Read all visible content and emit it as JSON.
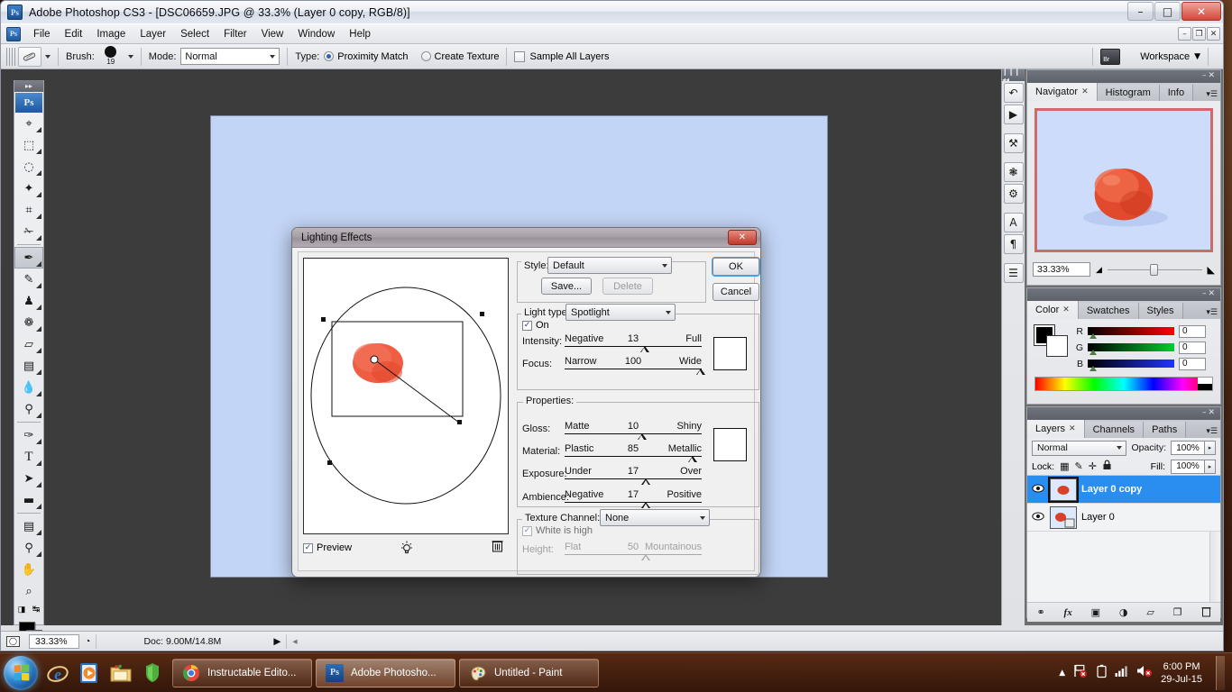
{
  "window": {
    "title": "Adobe Photoshop CS3 - [DSC06659.JPG @ 33.3% (Layer 0 copy, RGB/8)]",
    "app_badge": "Ps",
    "minimize": "–",
    "maximize": "□",
    "close": "✕"
  },
  "doc_buttons": {
    "minimize": "–",
    "restore": "❐",
    "close": "✕"
  },
  "menu": {
    "badge": "Ps",
    "items": [
      "File",
      "Edit",
      "Image",
      "Layer",
      "Select",
      "Filter",
      "View",
      "Window",
      "Help"
    ]
  },
  "options_bar": {
    "tool_icon": "spot-healing-brush-icon",
    "brush_label": "Brush:",
    "brush_size": "19",
    "mode_label": "Mode:",
    "mode_value": "Normal",
    "type_label": "Type:",
    "proximity_match": "Proximity Match",
    "create_texture": "Create Texture",
    "sample_all_layers": "Sample All Layers",
    "bridge_icon": "Br",
    "workspace_label": "Workspace",
    "caret": "▼",
    "check": "✓"
  },
  "toolbox": {
    "grip": "▸▸",
    "badge": "Ps",
    "tools": [
      {
        "name": "move-tool",
        "glyph": "⬌",
        "has_flyout": true
      },
      {
        "name": "rectangular-marquee-tool",
        "glyph": "⬚",
        "has_flyout": true
      },
      {
        "name": "lasso-tool",
        "glyph": "◌",
        "has_flyout": true
      },
      {
        "name": "magic-wand-tool",
        "glyph": "✦",
        "has_flyout": true
      },
      {
        "name": "crop-tool",
        "glyph": "⌘",
        "has_flyout": true
      },
      {
        "name": "slice-tool",
        "glyph": "✂",
        "has_flyout": true
      },
      {
        "name": "spot-healing-brush-tool",
        "glyph": "✒",
        "has_flyout": true,
        "selected": true
      },
      {
        "name": "brush-tool",
        "glyph": "✎",
        "has_flyout": true
      },
      {
        "name": "clone-stamp-tool",
        "glyph": "♟",
        "has_flyout": true
      },
      {
        "name": "history-brush-tool",
        "glyph": "❁",
        "has_flyout": true
      },
      {
        "name": "eraser-tool",
        "glyph": "▱",
        "has_flyout": true
      },
      {
        "name": "gradient-tool",
        "glyph": "▣",
        "has_flyout": true
      },
      {
        "name": "blur-tool",
        "glyph": "●",
        "has_flyout": true
      },
      {
        "name": "dodge-tool",
        "glyph": "⚲",
        "has_flyout": true
      },
      {
        "name": "pen-tool",
        "glyph": "✑",
        "has_flyout": true
      },
      {
        "name": "horizontal-type-tool",
        "glyph": "T",
        "has_flyout": true
      },
      {
        "name": "path-selection-tool",
        "glyph": "➤",
        "has_flyout": true
      },
      {
        "name": "rectangle-tool",
        "glyph": "▬",
        "has_flyout": true
      },
      {
        "name": "notes-tool",
        "glyph": "☰",
        "has_flyout": true
      },
      {
        "name": "eyedropper-tool",
        "glyph": "⚗",
        "has_flyout": true
      },
      {
        "name": "hand-tool",
        "glyph": "✋",
        "has_flyout": false
      },
      {
        "name": "zoom-tool",
        "glyph": "⌕",
        "has_flyout": false
      }
    ],
    "swap_icon": "↹",
    "default_colors_icon": "◨",
    "quickmask_icon": "◯"
  },
  "dialog": {
    "title": "Lighting Effects",
    "close": "✕",
    "preview_checkbox_label": "Preview",
    "preview_checked": "✓",
    "light_bulb_icon": "☀",
    "trash_icon": "Ὕ1",
    "style": {
      "label": "Style:",
      "value": "Default",
      "save_button": "Save...",
      "delete_button": "Delete",
      "caret": "▼"
    },
    "ok_button": "OK",
    "cancel_button": "Cancel",
    "light_type": {
      "label": "Light type:",
      "value": "Spotlight",
      "on_label": "On",
      "on_checked": "✓",
      "color_swatch": "#ffffff"
    },
    "sliders": [
      {
        "name": "intensity",
        "label": "Intensity:",
        "min_label": "Negative",
        "max_label": "Full",
        "value": "13",
        "pos_pct": 55
      },
      {
        "name": "focus",
        "label": "Focus:",
        "min_label": "Narrow",
        "max_label": "Wide",
        "value": "100",
        "pos_pct": 97
      }
    ],
    "properties": {
      "group_label": "Properties:",
      "color_swatch": "#ffffff",
      "sliders": [
        {
          "name": "gloss",
          "label": "Gloss:",
          "min_label": "Matte",
          "max_label": "Shiny",
          "value": "10",
          "pos_pct": 54
        },
        {
          "name": "material",
          "label": "Material:",
          "min_label": "Plastic",
          "max_label": "Metallic",
          "value": "85",
          "pos_pct": 91
        },
        {
          "name": "exposure",
          "label": "Exposure:",
          "min_label": "Under",
          "max_label": "Over",
          "value": "17",
          "pos_pct": 57
        },
        {
          "name": "ambience",
          "label": "Ambience:",
          "min_label": "Negative",
          "max_label": "Positive",
          "value": "17",
          "pos_pct": 57
        }
      ]
    },
    "texture": {
      "group_label": "Texture Channel:",
      "value": "None",
      "caret": "▼",
      "white_is_high_label": "White is high",
      "white_is_high_checked": "✓",
      "height": {
        "label": "Height:",
        "min_label": "Flat",
        "max_label": "Mountainous",
        "value": "50",
        "pos_pct": 57
      }
    }
  },
  "dock_rail": {
    "grip": "❙❙❙ ◂◂",
    "icons": [
      {
        "name": "history-icon",
        "glyph": "↶"
      },
      {
        "name": "actions-icon",
        "glyph": "▶"
      },
      {
        "name": "tool-presets-icon",
        "glyph": "⚒"
      },
      {
        "name": "brushes-icon",
        "glyph": "❃"
      },
      {
        "name": "clone-source-icon",
        "glyph": "⚙"
      },
      {
        "name": "character-icon",
        "glyph": "A"
      },
      {
        "name": "paragraph-icon",
        "glyph": "¶"
      },
      {
        "name": "layer-comps-icon",
        "glyph": "☰"
      }
    ]
  },
  "navigator_panel": {
    "tabs": [
      {
        "label": "Navigator",
        "active": true,
        "closable": true
      },
      {
        "label": "Histogram",
        "active": false,
        "closable": false
      },
      {
        "label": "Info",
        "active": false,
        "closable": false
      }
    ],
    "menu_icon": "▾☰",
    "minimize": "–",
    "close": "✕",
    "zoom_value": "33.33%",
    "zoom_out_icon": "◢",
    "zoom_in_icon": "◣"
  },
  "color_panel": {
    "tabs": [
      {
        "label": "Color",
        "active": true,
        "closable": true
      },
      {
        "label": "Swatches",
        "active": false,
        "closable": false
      },
      {
        "label": "Styles",
        "active": false,
        "closable": false
      }
    ],
    "menu_icon": "▾☰",
    "minimize": "–",
    "close": "✕",
    "foreground": "#000000",
    "background": "#ffffff",
    "channels": [
      {
        "label": "R",
        "value": "0",
        "color": "#ff0000"
      },
      {
        "label": "G",
        "value": "0",
        "color": "#00cc33"
      },
      {
        "label": "B",
        "value": "0",
        "color": "#2233ff"
      }
    ]
  },
  "layers_panel": {
    "tabs": [
      {
        "label": "Layers",
        "active": true,
        "closable": true
      },
      {
        "label": "Channels",
        "active": false,
        "closable": false
      },
      {
        "label": "Paths",
        "active": false,
        "closable": false
      }
    ],
    "menu_icon": "▾☰",
    "minimize": "–",
    "close": "✕",
    "blend_mode": "Normal",
    "blend_caret": "▼",
    "opacity_label": "Opacity:",
    "opacity_value": "100%",
    "lock_label": "Lock:",
    "lock_icons": [
      {
        "name": "lock-transparent-pixels-icon",
        "glyph": "▦"
      },
      {
        "name": "lock-image-pixels-icon",
        "glyph": "✎"
      },
      {
        "name": "lock-position-icon",
        "glyph": "✛"
      },
      {
        "name": "lock-all-icon",
        "glyph": "ὑ2"
      }
    ],
    "fill_label": "Fill:",
    "fill_value": "100%",
    "spinner": "▸",
    "layers": [
      {
        "name": "Layer 0 copy",
        "visible": true,
        "selected": true,
        "eye": "◉"
      },
      {
        "name": "Layer 0",
        "visible": true,
        "selected": false,
        "eye": "◉"
      }
    ],
    "footer_icons": [
      {
        "name": "link-layers-icon",
        "glyph": "⚭"
      },
      {
        "name": "layer-style-icon",
        "glyph": "fx"
      },
      {
        "name": "layer-mask-icon",
        "glyph": "▣"
      },
      {
        "name": "adjustment-layer-icon",
        "glyph": "◑"
      },
      {
        "name": "new-group-icon",
        "glyph": "▱"
      },
      {
        "name": "new-layer-icon",
        "glyph": "❐"
      },
      {
        "name": "delete-layer-icon",
        "glyph": "Ὕ1"
      }
    ]
  },
  "statusbar": {
    "quickmask_icon": "◯",
    "zoom": "33.33%",
    "doc_icon": "◔",
    "doc_info": "Doc: 9.00M/14.8M",
    "arrow": "▶",
    "left_arrow": "◂"
  },
  "taskbar": {
    "start_tooltip": "Start",
    "quick_launch": [
      {
        "name": "internet-explorer-icon",
        "glyph": "e"
      },
      {
        "name": "windows-media-player-icon",
        "glyph": "▶"
      },
      {
        "name": "windows-explorer-icon",
        "glyph": "὜0"
      },
      {
        "name": "security-icon",
        "glyph": "⛨"
      }
    ],
    "tasks": [
      {
        "label": "Instructable Edito...",
        "icon": "chrome-icon",
        "active": false
      },
      {
        "label": "Adobe Photosho...",
        "icon": "photoshop-icon",
        "active": true
      },
      {
        "label": "Untitled - Paint",
        "icon": "paint-icon",
        "active": false
      }
    ],
    "tray": [
      {
        "name": "show-hidden-icons-icon",
        "glyph": "▲"
      },
      {
        "name": "network-icon",
        "glyph": "὚7"
      },
      {
        "name": "battery-icon",
        "glyph": "ὐb"
      },
      {
        "name": "signal-icon",
        "glyph": "὏6"
      },
      {
        "name": "volume-muted-icon",
        "glyph": "ὐ8"
      }
    ],
    "clock_time": "6:00 PM",
    "clock_date": "29-Jul-15"
  }
}
